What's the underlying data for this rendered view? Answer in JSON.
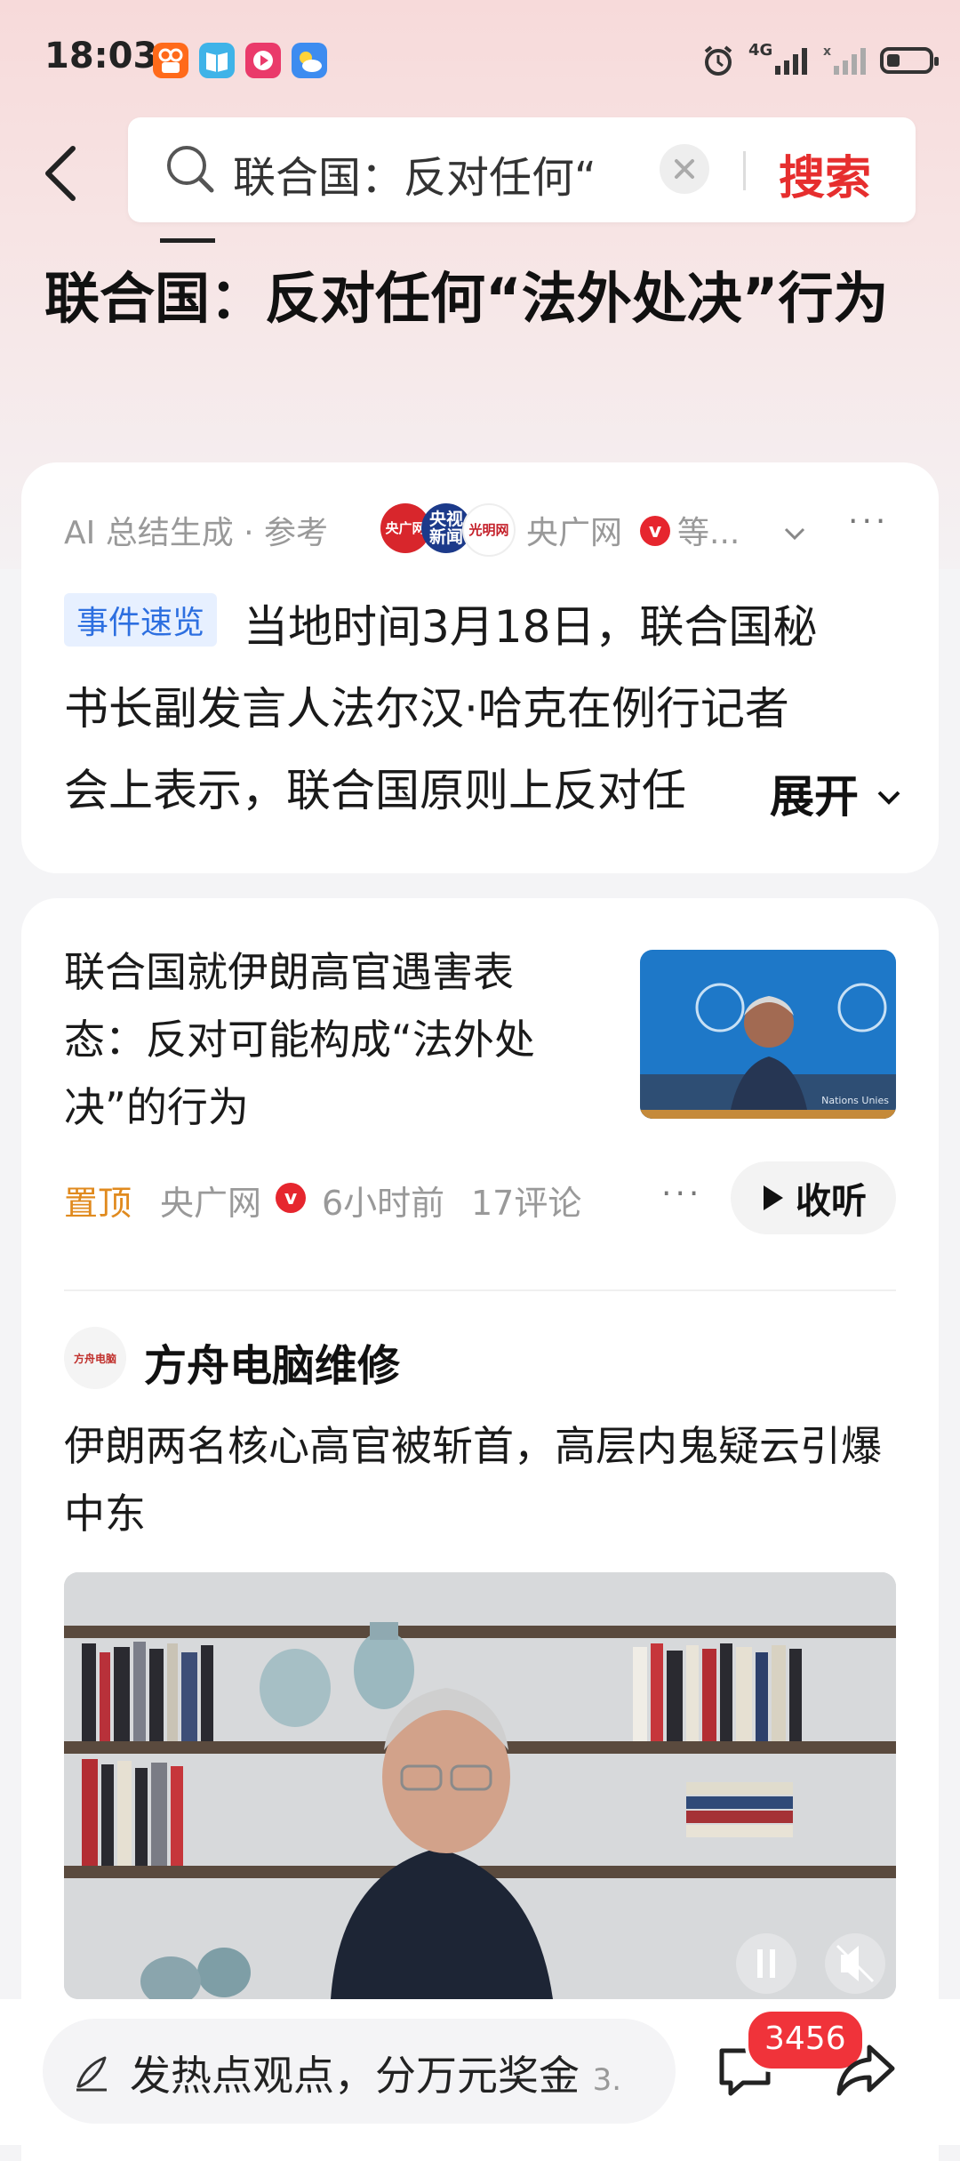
{
  "status_bar": {
    "time": "18:03",
    "network_label": "4G",
    "battery_level_percent": 35,
    "app_icons": [
      "kuaishou-icon",
      "book-reader-icon",
      "video-play-icon",
      "weather-icon"
    ],
    "indicator_icons": [
      "alarm-icon",
      "signal-4g-icon",
      "signal-nosim-icon",
      "battery-icon"
    ]
  },
  "header": {
    "search_query": "联合国：反对任何“",
    "search_button": "搜索"
  },
  "page_title": "联合国：反对任何“法外处决”行为",
  "ai_summary": {
    "meta_label": "AI 总结生成 · 参考",
    "source_logos": [
      "央广网",
      "央视新闻",
      "光明网"
    ],
    "source_name": "央广网",
    "source_suffix": "等...",
    "verified_mark": "v",
    "tag": "事件速览",
    "lines": [
      "当地时间3月18日，联合国秘",
      "书长副发言人法尔汉·哈克在例行记者",
      "会上表示，联合国原则上反对任"
    ],
    "expand_label": "展开"
  },
  "news_item": {
    "title": "联合国就伊朗高官遇害表态：反对可能构成“法外处决”的行为",
    "pin_label": "置顶",
    "source": "央广网",
    "verified_mark": "v",
    "time_ago": "6小时前",
    "comments": "17评论",
    "listen_label": "收听",
    "thumb_caption": "Nations Unies"
  },
  "post": {
    "author_name": "方舟电脑维修",
    "author_logo_text": "方舟电脑",
    "text": "伊朗两名核心高官被斩首，高层内鬼疑云引爆中东"
  },
  "bottom_bar": {
    "comment_placeholder": "发热点观点，分万元奖金",
    "comment_suffix": "3.",
    "comment_count": "3456"
  },
  "colors": {
    "accent_red": "#e62e2e",
    "tag_blue": "#2d6fe0",
    "pin_orange": "#e08a1e"
  }
}
